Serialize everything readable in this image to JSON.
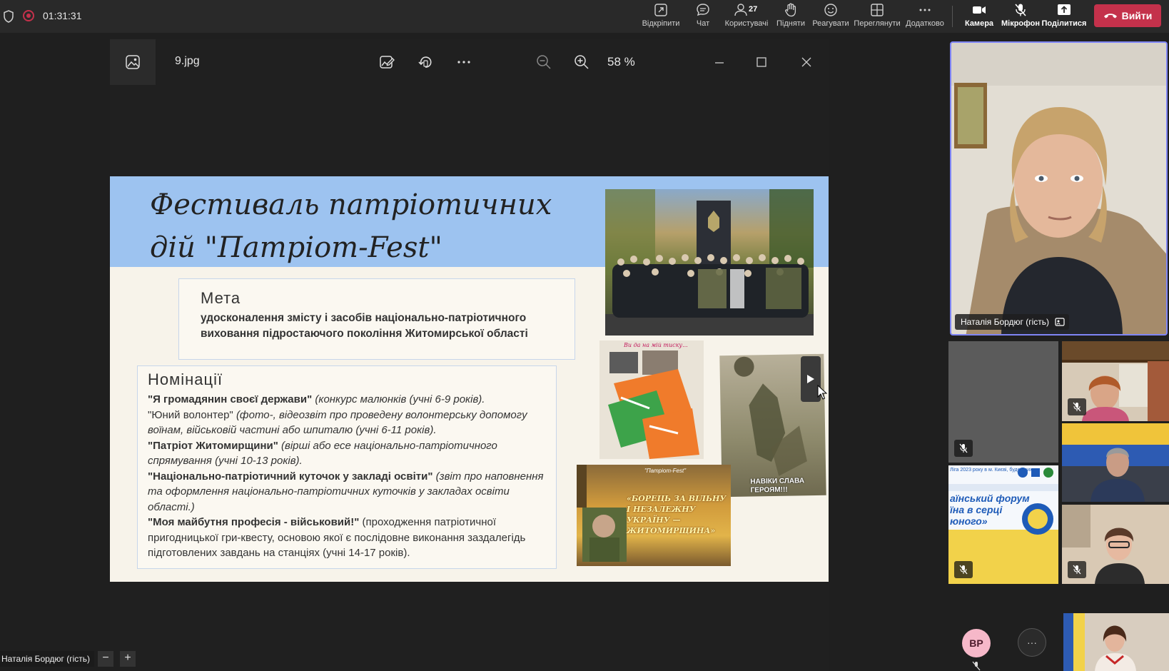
{
  "meeting": {
    "timer": "01:31:31",
    "toolbar": [
      {
        "id": "open",
        "label": "Відкріпити",
        "icon": "popout-icon"
      },
      {
        "id": "chat",
        "label": "Чат",
        "icon": "chat-icon"
      },
      {
        "id": "people",
        "label": "Користувачі",
        "icon": "people-icon",
        "count": "27"
      },
      {
        "id": "raise",
        "label": "Підняти",
        "icon": "raise-hand-icon"
      },
      {
        "id": "react",
        "label": "Реагувати",
        "icon": "smiley-icon"
      },
      {
        "id": "view",
        "label": "Переглянути",
        "icon": "layout-icon"
      },
      {
        "id": "more",
        "label": "Додатково",
        "icon": "more-icon"
      }
    ],
    "camera_label": "Камера",
    "mic_label": "Мікрофон",
    "share_label": "Поділитися",
    "leave_label": "Вийти",
    "colors": {
      "leave": "#c4314b",
      "highlight": "#7f85f5"
    }
  },
  "viewer": {
    "filename": "9.jpg",
    "zoom": "58 %"
  },
  "slide": {
    "title_line1": "Фестиваль патріотичних",
    "title_line2": "дій \"Патріот-Fest\"",
    "goal_heading": "Мета",
    "goal_text": "удосконалення змісту і засобів національно-патріотичного виховання підростаючого покоління Житомирської області",
    "nominations_heading": "Номінації",
    "nominations": [
      {
        "bold": "\"Я громадянин своєї держави\"",
        "italic": " (конкурс малюнків (учні 6-9 років).",
        "plain": ""
      },
      {
        "bold": "",
        "italic": "",
        "plain": "\"Юний волонтер\" "
      },
      {
        "bold": "",
        "italic": "(фото-, відеозвіт про проведену волонтерську допомогу воїнам, військовій частині або шпиталю (учні 6-11 років).",
        "plain": ""
      },
      {
        "bold": "\"Патріот Житомирщини\"",
        "italic": " (вірші або есе національно-патріотичного спрямування (учні 10-13 років).",
        "plain": ""
      },
      {
        "bold": "\"Національно-патріотичний куточок у закладі освіти\"",
        "italic": " (звіт про наповнення та оформлення національно-патріотичних куточків у закладах освіти області.)",
        "plain": ""
      },
      {
        "bold": "\"Моя майбутня професія - військовий!\"",
        "italic": "",
        "plain": " (проходження патріотичної пригодницької гри-квесту, основою якої є послідовне виконання заздалегідь підготовлених завдань на станціях (учні 14-17 років)."
      }
    ],
    "photo_captions": {
      "card": "Ви да на мій тиску...",
      "poster_top": "\"Патріот-Fest\"",
      "poster_main": "«БОРЕЦЬ ЗА ВІЛЬНУ І НЕЗАЛЕЖНУ УКРАЇНУ — ЖИТОМИРЩИНА»",
      "memorial": "НАВІКИ СЛАВА ГЕРОЯМ!!!"
    }
  },
  "participants": {
    "main_name": "Наталія Бордюг (гість)",
    "avatar_initials": "ВР",
    "bottom_name": "Наталія Бордюг (гість)",
    "tile_banner": {
      "line1": "Ліга 2023 року в м. Києві, буде прих",
      "line2": "аїнський форум",
      "line3": "їна в серці",
      "line4": "юного»"
    }
  }
}
